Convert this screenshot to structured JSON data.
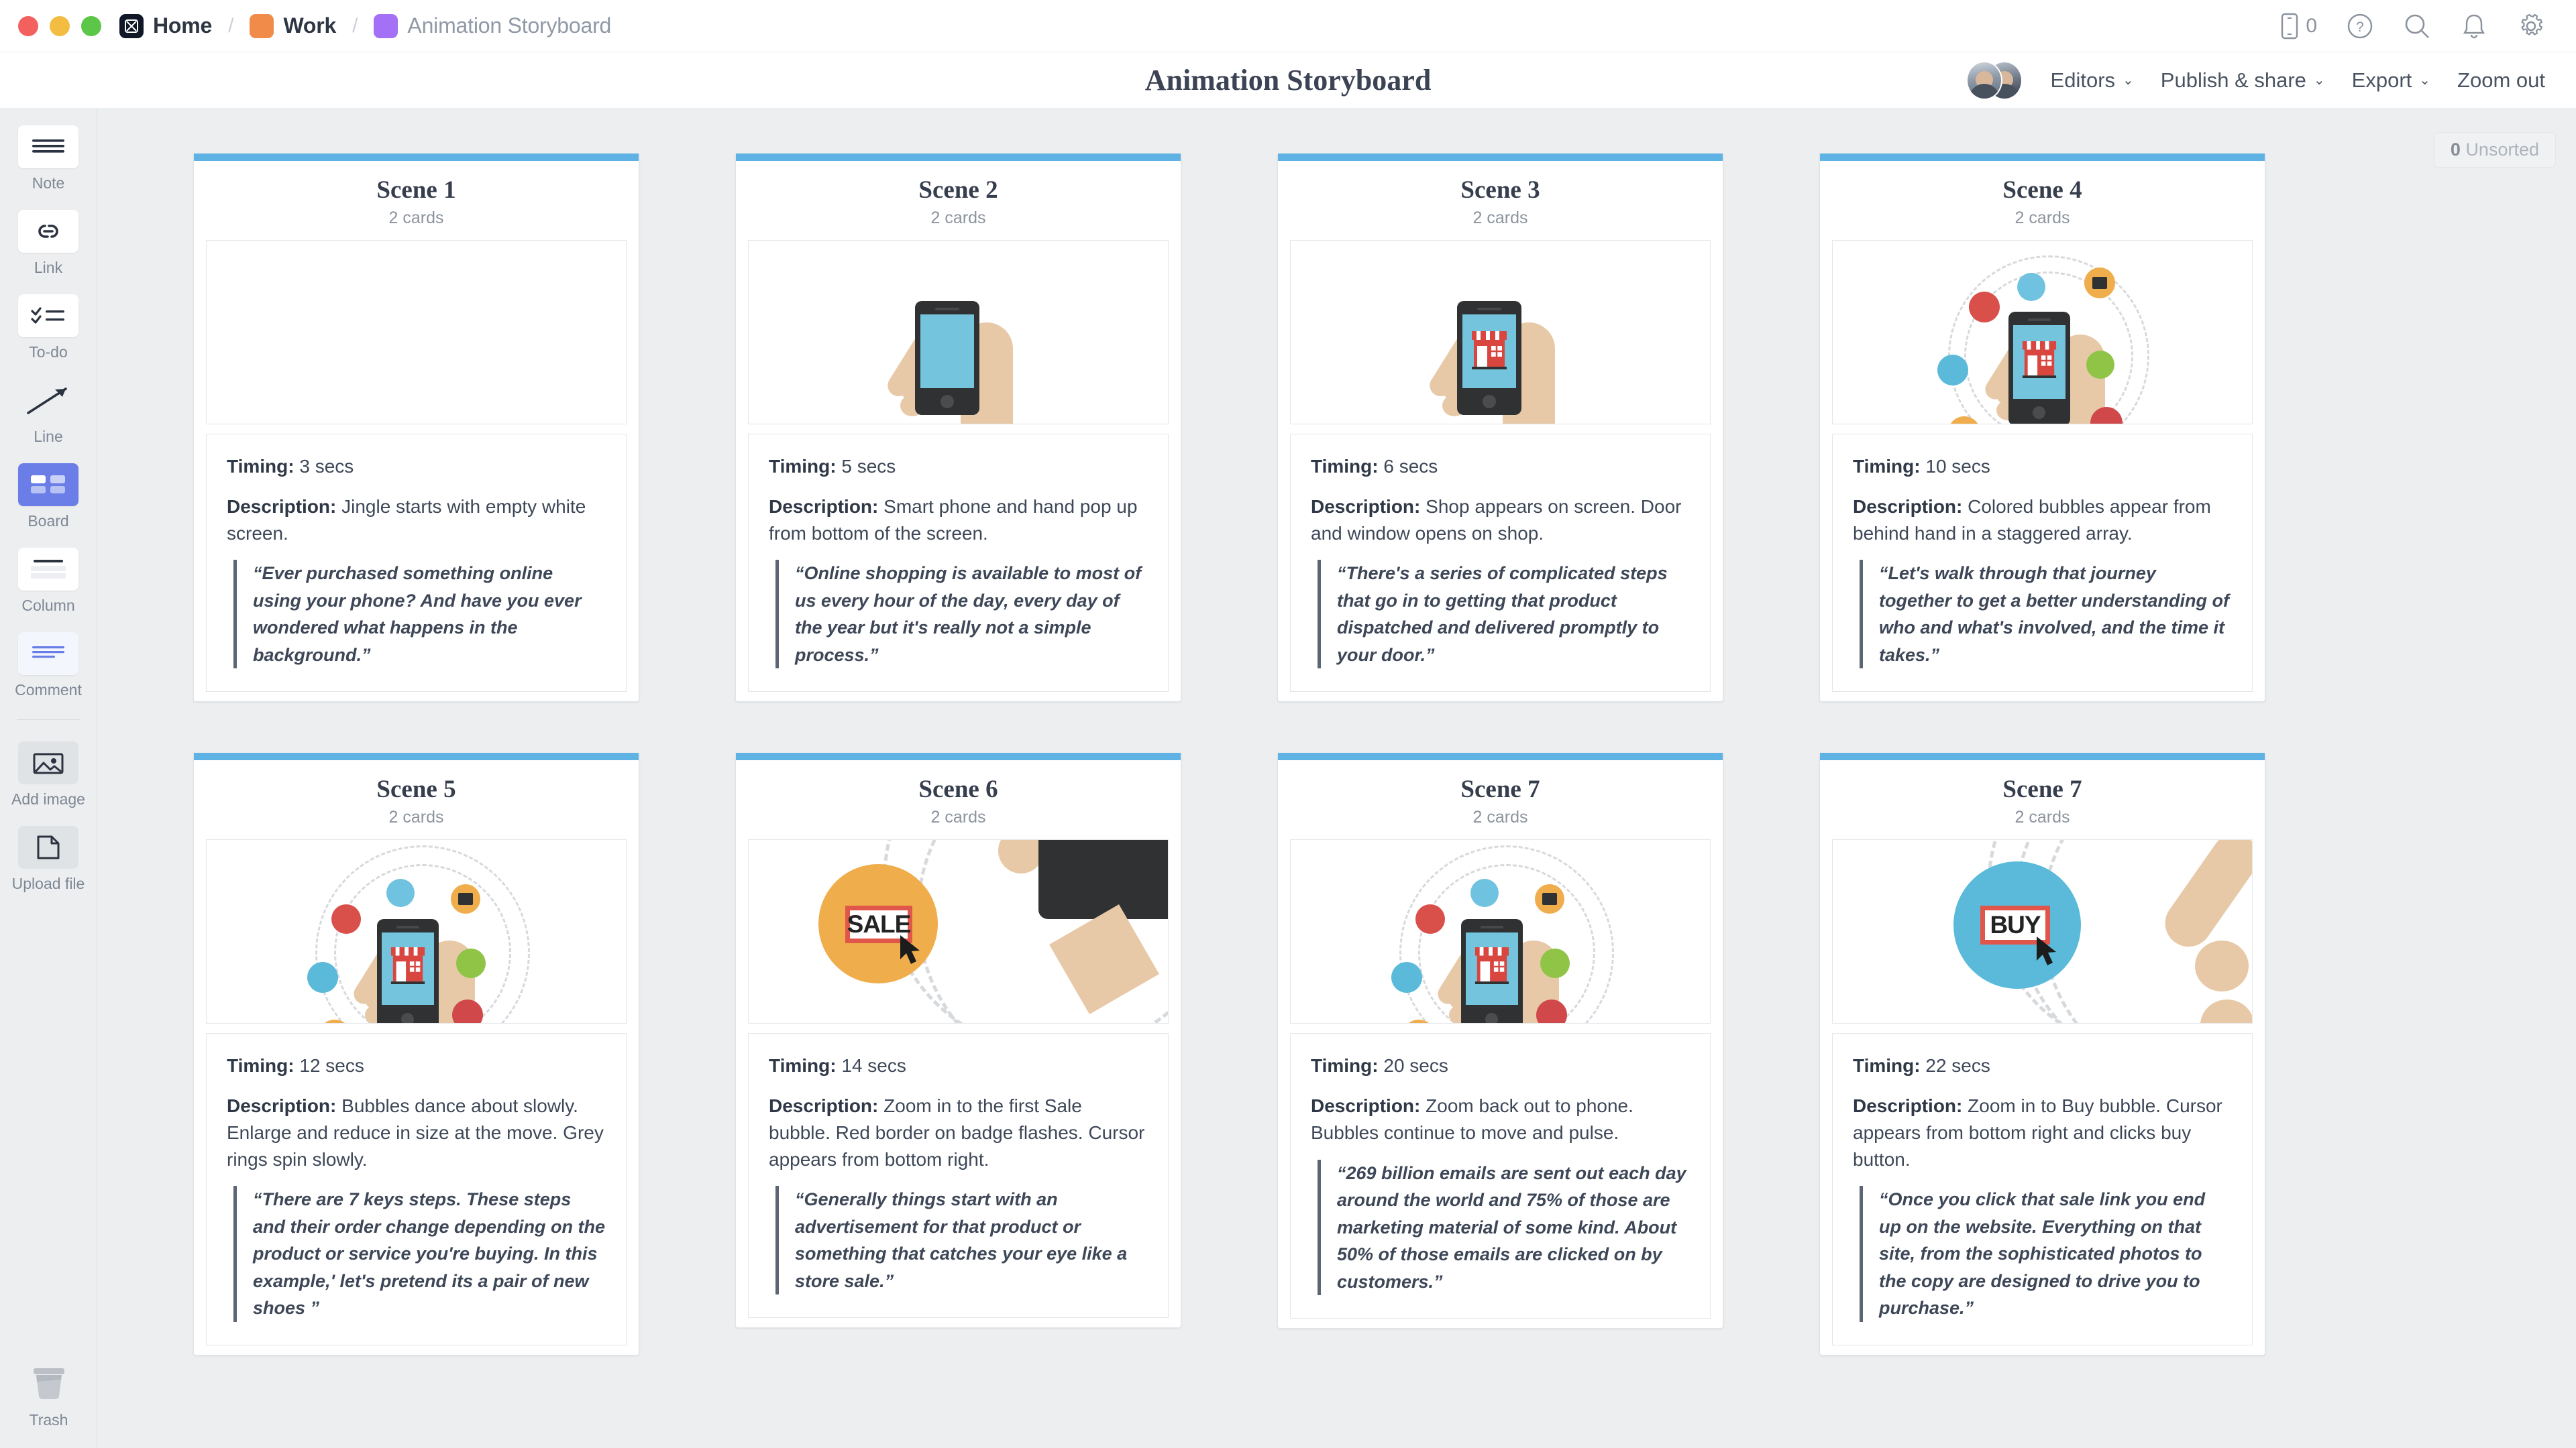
{
  "window": {
    "traffic_lights": [
      "close",
      "minimize",
      "zoom"
    ]
  },
  "breadcrumb": {
    "home": "Home",
    "work": "Work",
    "current": "Animation Storyboard",
    "separator": "/"
  },
  "topbar_icons": [
    {
      "name": "mobile-card-count-icon",
      "value": "0"
    },
    {
      "name": "help-icon",
      "value": "?"
    },
    {
      "name": "search-icon",
      "value": ""
    },
    {
      "name": "notifications-icon",
      "value": ""
    },
    {
      "name": "settings-gear-icon",
      "value": ""
    }
  ],
  "header": {
    "title": "Animation Storyboard",
    "menus": [
      {
        "label": "Editors",
        "caret": "⌄"
      },
      {
        "label": "Publish & share",
        "caret": "⌄"
      },
      {
        "label": "Export",
        "caret": "⌄"
      }
    ],
    "zoom_out": "Zoom out"
  },
  "sidebar": {
    "items": [
      {
        "label": "Note",
        "icon": "note-icon",
        "selected": false
      },
      {
        "label": "Link",
        "icon": "link-icon",
        "selected": false
      },
      {
        "label": "To-do",
        "icon": "todo-icon",
        "selected": false
      },
      {
        "label": "Line",
        "icon": "line-arrow-icon",
        "selected": false
      },
      {
        "label": "Board",
        "icon": "board-icon",
        "selected": true
      },
      {
        "label": "Column",
        "icon": "column-icon",
        "selected": false
      },
      {
        "label": "Comment",
        "icon": "comment-icon",
        "selected": false
      },
      {
        "label": "Add image",
        "icon": "add-image-icon",
        "selected": false
      },
      {
        "label": "Upload file",
        "icon": "upload-file-icon",
        "selected": false
      }
    ],
    "trash": {
      "label": "Trash",
      "icon": "trash-icon"
    }
  },
  "board": {
    "unsorted_count": "0",
    "unsorted_label": "Unsorted",
    "accent_color": "#5eb3e4",
    "labels": {
      "timing": "Timing:",
      "description": "Description:"
    },
    "columns": [
      {
        "title": "Scene 1",
        "cards_count": "2 cards",
        "illustration": "blank-white-screen",
        "timing": "3 secs",
        "description": "Jingle starts with empty white screen.",
        "quote": "“Ever purchased something online using your phone? And have you ever wondered what happens in the background.”"
      },
      {
        "title": "Scene 2",
        "cards_count": "2 cards",
        "illustration": "hand-holding-phone-blank-screen",
        "timing": "5 secs",
        "description": "Smart phone and hand pop up from bottom of the screen.",
        "quote": "“Online shopping is available to most of us every hour of the day, every day of the year but it's really not a simple process.”"
      },
      {
        "title": "Scene 3",
        "cards_count": "2 cards",
        "illustration": "hand-holding-phone-shop-screen",
        "timing": "6 secs",
        "description": "Shop appears on screen. Door and window opens on shop.",
        "quote": "“There's  a series of complicated steps that go in to getting that product dispatched and delivered promptly to your door.”"
      },
      {
        "title": "Scene 4",
        "cards_count": "2 cards",
        "illustration": "phone-with-colored-bubbles",
        "timing": "10 secs",
        "description": "Colored bubbles appear from behind hand in a staggered array.",
        "quote": "“Let's walk through that journey together to get a better understanding of who and what's involved, and the time it takes.”"
      },
      {
        "title": "Scene 5",
        "cards_count": "2 cards",
        "illustration": "phone-with-colored-bubbles-wide",
        "timing": "12 secs",
        "description": "Bubbles dance about slowly. Enlarge and reduce in size at the move. Grey rings spin slowly.",
        "quote": "“There are 7 keys steps. These steps and their order change depending on the product or service you're buying. In this example,' let's pretend its a pair of new shoes ”"
      },
      {
        "title": "Scene 6",
        "cards_count": "2 cards",
        "illustration": "sale-bubble-zoom-with-cursor",
        "timing": "14 secs",
        "description": "Zoom in to the first Sale bubble. Red border on badge flashes. Cursor appears from bottom right.",
        "quote": "“Generally things start with an advertisement for that product or something that catches your eye like a store sale.”"
      },
      {
        "title": "Scene 7",
        "cards_count": "2 cards",
        "illustration": "phone-with-colored-bubbles-wide",
        "timing": "20 secs",
        "description": "Zoom back out to phone. Bubbles continue to move and pulse.",
        "quote": "“269 billion emails are sent out each day around the world and 75% of those are marketing material of some kind. About 50% of those emails are clicked on by customers.”"
      },
      {
        "title": "Scene 7",
        "cards_count": "2 cards",
        "illustration": "buy-bubble-zoom-with-cursor",
        "timing": "22 secs",
        "description": "Zoom in to Buy bubble. Cursor appears from bottom right and clicks buy button.",
        "quote": "“Once you click that sale link you end up on the website. Everything on that site, from the sophisticated photos to the copy are designed to drive you to purchase.”"
      }
    ]
  },
  "illustration_text": {
    "sale": "SALE",
    "buy": "BUY"
  }
}
